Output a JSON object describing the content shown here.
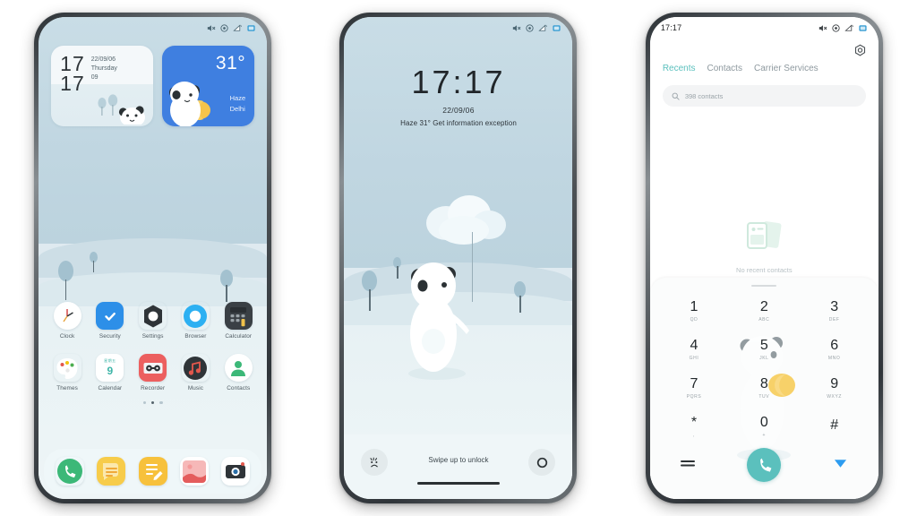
{
  "phones": [
    {
      "id": "home-screen",
      "statusbar": {
        "time": "",
        "icons": [
          "mute-icon",
          "alarm-icon",
          "wifi-icon",
          "battery-icon"
        ]
      },
      "widgets": {
        "clock": {
          "hour": "17",
          "minute": "17",
          "date": "22/09/06",
          "weekday": "Thursday",
          "extra": "09"
        },
        "weather": {
          "temperature": "31°",
          "condition": "Haze",
          "city": "Delhi",
          "bg_color": "#3f7fe0"
        }
      },
      "apps_row1": [
        {
          "label": "Clock",
          "icon": "clock-icon"
        },
        {
          "label": "Security",
          "icon": "shield-check-icon"
        },
        {
          "label": "Settings",
          "icon": "gear-icon"
        },
        {
          "label": "Browser",
          "icon": "browser-icon"
        },
        {
          "label": "Calculator",
          "icon": "calculator-icon"
        }
      ],
      "apps_row2": [
        {
          "label": "Themes",
          "icon": "palette-icon"
        },
        {
          "label": "Calendar",
          "icon": "calendar-icon",
          "day": "9"
        },
        {
          "label": "Recorder",
          "icon": "recorder-icon"
        },
        {
          "label": "Music",
          "icon": "music-note-icon"
        },
        {
          "label": "Contacts",
          "icon": "contacts-person-icon"
        }
      ],
      "page_dots": {
        "count": 3,
        "active_index": 1
      },
      "dock": [
        {
          "label": "Phone",
          "icon": "phone-icon"
        },
        {
          "label": "Messages",
          "icon": "messages-icon"
        },
        {
          "label": "Notes",
          "icon": "notes-pencil-icon"
        },
        {
          "label": "Gallery",
          "icon": "gallery-icon"
        },
        {
          "label": "Camera",
          "icon": "camera-icon"
        }
      ]
    },
    {
      "id": "lock-screen",
      "statusbar": {
        "time": "",
        "icons": [
          "mute-icon",
          "alarm-icon",
          "wifi-icon",
          "battery-icon"
        ]
      },
      "clock": {
        "time": "17:17",
        "date": "22/09/06",
        "info": "Haze 31° Get information exception"
      },
      "bottom": {
        "left_icon": "emoji-face-icon",
        "right_icon": "camera-circle-icon",
        "hint": "Swipe up to unlock"
      }
    },
    {
      "id": "dialer-screen",
      "statusbar": {
        "time": "17:17",
        "icons": [
          "mute-icon",
          "alarm-icon",
          "wifi-icon",
          "battery-icon"
        ]
      },
      "settings_icon": "gear-icon",
      "tabs": [
        {
          "label": "Recents",
          "active": true
        },
        {
          "label": "Contacts",
          "active": false
        },
        {
          "label": "Carrier Services",
          "active": false
        }
      ],
      "search": {
        "icon": "search-icon",
        "placeholder": "398 contacts"
      },
      "empty_state": {
        "icon": "contact-cards-icon",
        "text": "No recent contacts"
      },
      "keypad": [
        {
          "digit": "1",
          "letters": "QD"
        },
        {
          "digit": "2",
          "letters": "ABC"
        },
        {
          "digit": "3",
          "letters": "DEF"
        },
        {
          "digit": "4",
          "letters": "GHI"
        },
        {
          "digit": "5",
          "letters": "JKL"
        },
        {
          "digit": "6",
          "letters": "MNO"
        },
        {
          "digit": "7",
          "letters": "PQRS"
        },
        {
          "digit": "8",
          "letters": "TUV"
        },
        {
          "digit": "9",
          "letters": "WXYZ"
        },
        {
          "digit": "*",
          "letters": ","
        },
        {
          "digit": "0",
          "letters": "+"
        },
        {
          "digit": "#",
          "letters": ""
        }
      ],
      "bottom_bar": {
        "left_icon": "menu-lines-icon",
        "call_icon": "phone-icon",
        "right_icon": "collapse-triangle-icon"
      },
      "accent_color": "#5bc0bd"
    }
  ],
  "theme": {
    "wallpaper_sky": "#c5dae4",
    "wallpaper_snow": "#eaf3f5",
    "weather_blue": "#3f7fe0",
    "dialer_teal": "#5bc0bd"
  }
}
